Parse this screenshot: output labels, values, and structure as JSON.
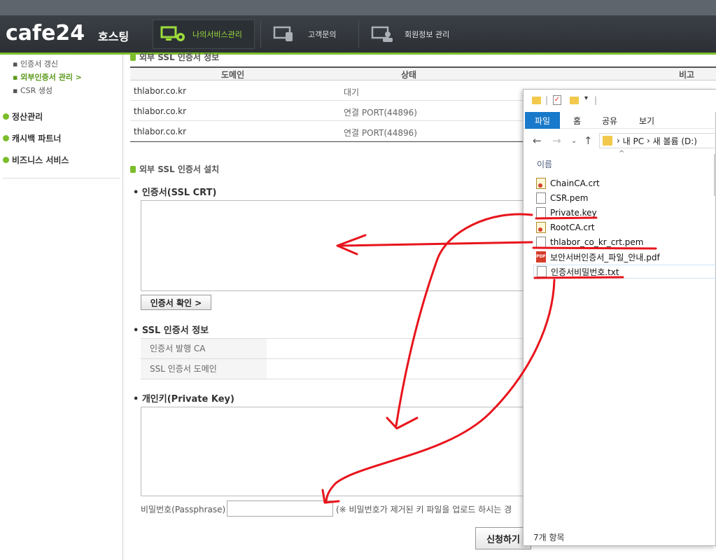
{
  "header": {
    "logo": "cafe24",
    "logo_sub": "호스팅",
    "nav": [
      {
        "label": "나의서비스관리",
        "active": true
      },
      {
        "label": "고객문의",
        "active": false
      },
      {
        "label": "회원정보 관리",
        "active": false
      }
    ]
  },
  "sidebar": {
    "sub_items": [
      "인증서 갱신",
      "외부인증서 관리 >",
      "CSR 생성"
    ],
    "menu_items": [
      "정산관리",
      "캐시백 파트너",
      "비즈니스 서비스"
    ]
  },
  "main": {
    "top_section": "외부 SSL 인증서 정보",
    "table": {
      "headers": [
        "도메인",
        "상태",
        "비고"
      ],
      "rows": [
        [
          "thlabor.co.kr",
          "대기"
        ],
        [
          "thlabor.co.kr",
          "연결 PORT(44896)"
        ],
        [
          "thlabor.co.kr",
          "연결 PORT(44896)"
        ]
      ]
    },
    "install_section": "외부 SSL 인증서 설치",
    "crt_title": "인증서(SSL CRT)",
    "check_button": "인증서 확인 >",
    "info_title": "SSL 인증서 정보",
    "info_labels": [
      "인증서 발행 CA",
      "SSL 인증서 도메인"
    ],
    "key_title": "개인키(Private Key)",
    "pw_label": "비밀번호(Passphrase)",
    "pw_note": "(※ 비밀번호가 제거된 키 파일을 업로드 하시는 경",
    "submit_button": "신청하기"
  },
  "explorer": {
    "ribbon_tabs": [
      "파일",
      "홈",
      "공유",
      "보기"
    ],
    "address": [
      "내 PC",
      "새 볼륨 (D:)"
    ],
    "column": "이름",
    "files": [
      {
        "name": "ChainCA.crt",
        "icon": "cert-icon"
      },
      {
        "name": "CSR.pem",
        "icon": "doc-icon"
      },
      {
        "name": "Private.key",
        "icon": "doc-icon"
      },
      {
        "name": "RootCA.crt",
        "icon": "cert-icon"
      },
      {
        "name": "thlabor_co_kr_crt.pem",
        "icon": "doc-icon"
      },
      {
        "name": "보안서버인증서_파일_안내.pdf",
        "icon": "pdf-icon"
      },
      {
        "name": "인증서비밀번호.txt",
        "icon": "txt-icon"
      }
    ],
    "status": "7개 항목"
  },
  "colors": {
    "accent_green": "#7bbd2a",
    "annotation_red": "#e8141c",
    "ribbon_blue": "#1979ca"
  }
}
